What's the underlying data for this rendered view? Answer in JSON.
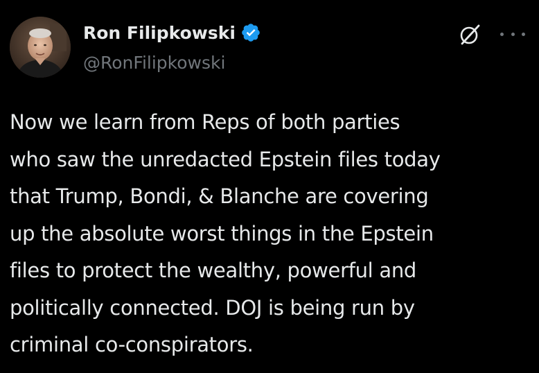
{
  "tweet": {
    "author": {
      "display_name": "Ron Filipkowski",
      "handle": "@RonFilipkowski",
      "verified": true,
      "avatar_icon": "profile-photo"
    },
    "actions": {
      "grok_icon": "grok-icon",
      "more_icon": "more-options-icon"
    },
    "text": "Now we learn from Reps of both parties\nwho saw the unredacted Epstein files today\nthat Trump, Bondi, & Blanche are covering\nup the absolute worst things in the Epstein\nfiles to protect the wealthy, powerful and\npolitically connected. DOJ is being run by\ncriminal co-conspirators."
  },
  "colors": {
    "background": "#000000",
    "primary_text": "#e7e9ea",
    "secondary_text": "#71767b",
    "verified_blue": "#1d9bf0"
  }
}
